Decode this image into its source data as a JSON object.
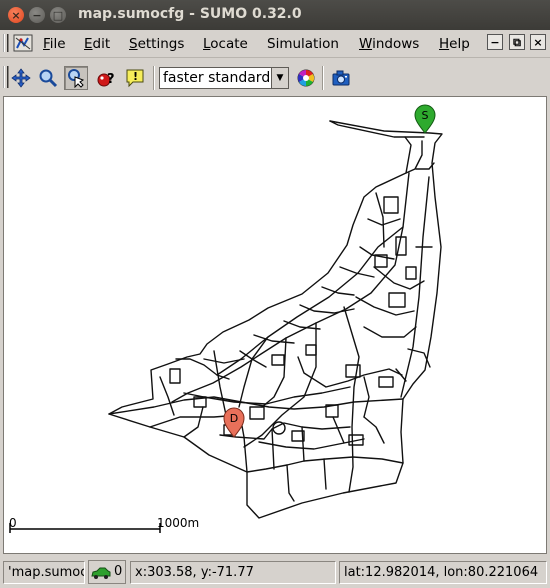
{
  "window": {
    "title": "map.sumocfg - SUMO 0.32.0",
    "close_glyph": "×",
    "minimize_glyph": "−",
    "maximize_glyph": "□"
  },
  "menubar": {
    "items": [
      {
        "label_ul": "F",
        "label_rest": "ile"
      },
      {
        "label_ul": "E",
        "label_rest": "dit"
      },
      {
        "label_ul": "S",
        "label_rest": "ettings"
      },
      {
        "label_ul": "L",
        "label_rest": "ocate"
      },
      {
        "label_ul": "",
        "label_rest": "Simulation"
      },
      {
        "label_ul": "W",
        "label_rest": "indows"
      },
      {
        "label_ul": "H",
        "label_rest": "elp"
      }
    ],
    "mdi_minimize_glyph": "−",
    "mdi_restore_glyph": "⧉",
    "mdi_close_glyph": "×"
  },
  "toolbar": {
    "icons": [
      "recenter-icon",
      "zoom-icon",
      "locate-icon",
      "breakpoint-icon",
      "tooltip-icon",
      "color-wheel-icon",
      "screenshot-icon"
    ],
    "color_scheme": {
      "selected": "faster standard"
    },
    "dropdown_glyph": "▼"
  },
  "map": {
    "start_marker": "S",
    "destination_marker": "D",
    "start_color": "#2eaa2e",
    "destination_color": "#e8705a",
    "scale": {
      "start": "0",
      "end": "1000m"
    }
  },
  "status": {
    "file": "'map.sumocfg",
    "vehicles": "0",
    "coords": "x:303.58, y:-71.77",
    "geo": "lat:12.982014, lon:80.221064"
  }
}
